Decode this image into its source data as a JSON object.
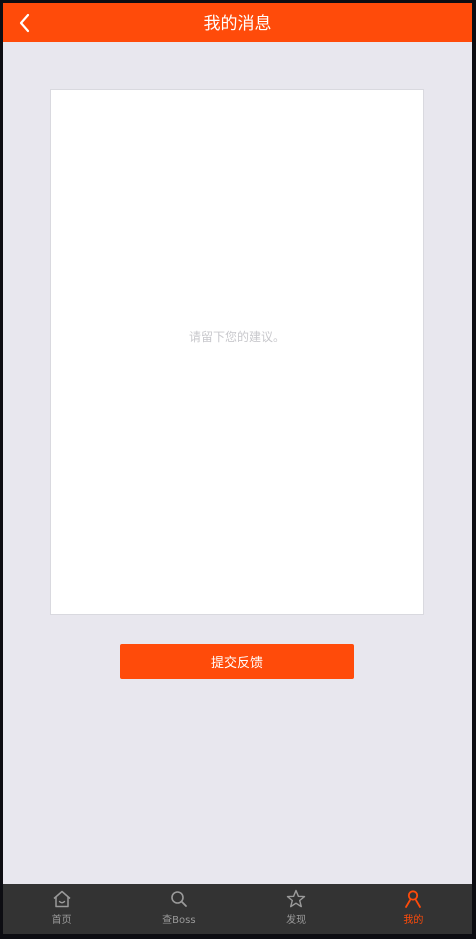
{
  "header": {
    "title": "我的消息",
    "back_icon": "chevron-left-icon"
  },
  "feedback": {
    "placeholder": "请留下您的建议。",
    "value": ""
  },
  "submit": {
    "label": "提交反馈"
  },
  "tabbar": {
    "items": [
      {
        "label": "首页",
        "icon": "home-icon",
        "active": false
      },
      {
        "label": "查Boss",
        "icon": "search-icon",
        "active": false
      },
      {
        "label": "发现",
        "icon": "star-icon",
        "active": false
      },
      {
        "label": "我的",
        "icon": "user-icon",
        "active": true
      }
    ]
  },
  "colors": {
    "accent": "#ff4b0a",
    "background": "#e8e7ee",
    "tabbar": "#333333",
    "tab_inactive": "#9a9a9a"
  }
}
